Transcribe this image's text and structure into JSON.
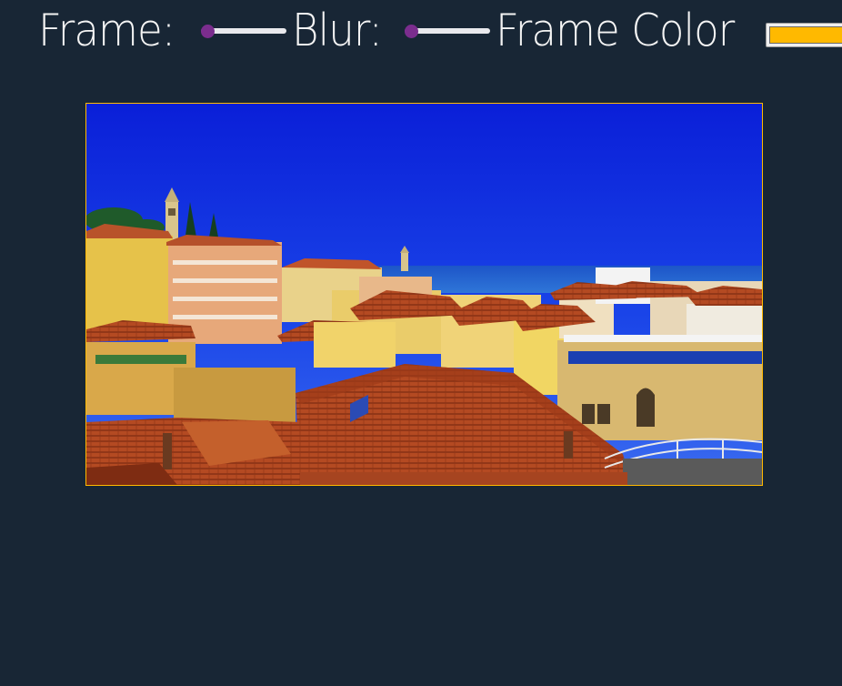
{
  "controls": {
    "frame_label": "Frame:",
    "frame_value": 0,
    "blur_label": "Blur:",
    "blur_value": 0,
    "frame_color_label": "Frame Color",
    "frame_color": "#ffb900"
  },
  "colors": {
    "background": "#182635",
    "slider_accent": "#7b2d8e",
    "slider_track": "#e9e9ed"
  },
  "photo": {
    "subject": "coastal-town-rooftops-photo"
  }
}
